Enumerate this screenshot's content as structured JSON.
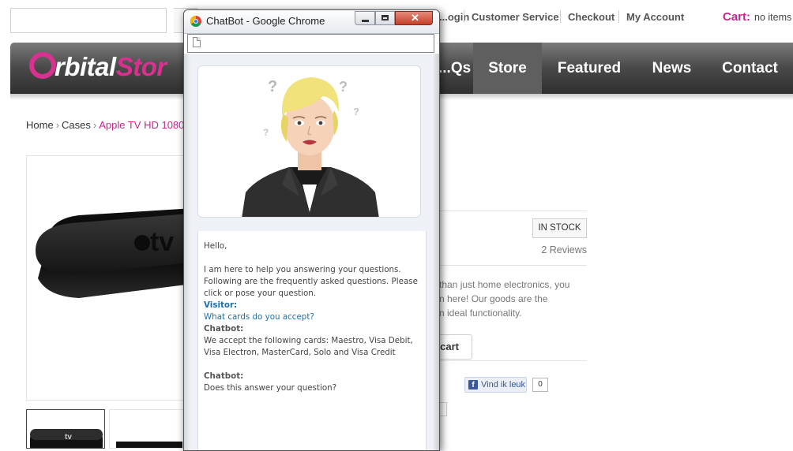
{
  "header": {
    "links": [
      "...ogin",
      "Customer Service",
      "Checkout",
      "My Account"
    ],
    "cart_label": "Cart:",
    "cart_value": "no items"
  },
  "nav": {
    "logo_prefix": "rbital",
    "logo_brand": "Stor",
    "items": [
      {
        "label": "...Qs",
        "active": false
      },
      {
        "label": "Store",
        "active": true
      },
      {
        "label": "Featured",
        "active": false
      },
      {
        "label": "News",
        "active": false
      },
      {
        "label": "Contact",
        "active": false
      }
    ]
  },
  "breadcrumb": {
    "home": "Home",
    "category": "Cases",
    "current": "Apple TV HD 1080",
    "separator": "›"
  },
  "product": {
    "stock_status": "IN STOCK",
    "reviews": "2 Reviews",
    "description_lines": [
      "than just home electronics, you",
      "n here! Our goods are the",
      "n ideal functionality."
    ],
    "add_to_cart_label": "cart",
    "fb_like_label": "Vind ik leuk",
    "fb_like_count": "0"
  },
  "popup": {
    "window_title": "ChatBot - Google Chrome",
    "chat": [
      {
        "type": "text",
        "text": "Hello,"
      },
      {
        "type": "blank"
      },
      {
        "type": "text",
        "text": "I am here to help you answering your questions. Following are the frequently asked questions. Please click or pose your question."
      },
      {
        "type": "speaker",
        "role": "visitor",
        "text": "Visitor:"
      },
      {
        "type": "visitor",
        "text": "What cards do you accept?"
      },
      {
        "type": "speaker",
        "role": "bot",
        "text": "Chatbot:"
      },
      {
        "type": "text",
        "text": "We accept the following cards: Maestro, Visa Debit, Visa Electron, MasterCard, Solo and Visa Credit"
      },
      {
        "type": "blank"
      },
      {
        "type": "speaker",
        "role": "bot",
        "text": "Chatbot:"
      },
      {
        "type": "text",
        "text": "Does this answer your question?"
      }
    ]
  },
  "colors": {
    "brand_pink": "#c2278e",
    "nav_dark": "#3a3a3a",
    "visitor_blue": "#1a6fa8",
    "close_red": "#c4402a"
  },
  "icons": [
    "search-icon",
    "chrome-icon",
    "page-icon",
    "minimize-icon",
    "maximize-icon",
    "close-icon",
    "facebook-icon"
  ]
}
